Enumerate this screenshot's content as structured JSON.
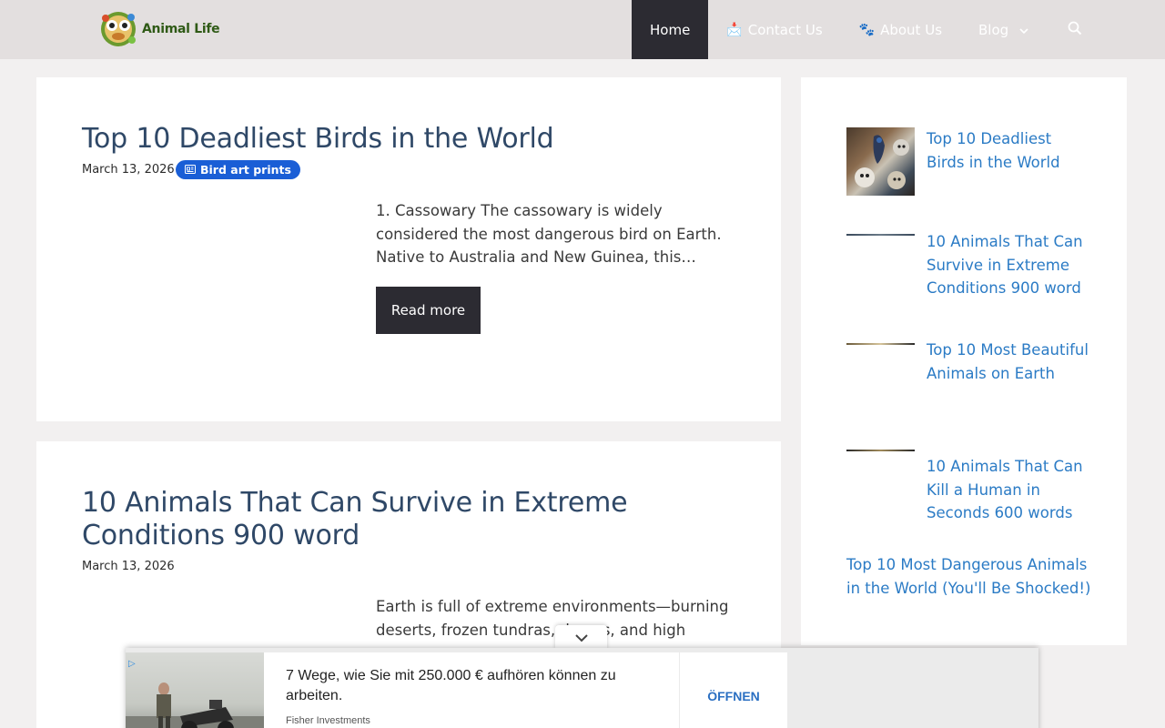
{
  "header": {
    "logo_text": "Animal Life",
    "nav": [
      {
        "label": "Home",
        "icon": "",
        "active": true
      },
      {
        "label": "Contact Us",
        "icon": "📩"
      },
      {
        "label": "About Us",
        "icon": "🐾"
      },
      {
        "label": "Blog",
        "icon": ""
      }
    ]
  },
  "posts": [
    {
      "title": "Top 10 Deadliest Birds in the World",
      "date": "March 13, 2026",
      "badge": "Bird art prints",
      "excerpt": "1. Cassowary The cassowary is widely considered the most dangerous bird on Earth. Native to Australia and New Guinea, this…",
      "read_more": "Read more"
    },
    {
      "title": "10 Animals That Can Survive in Extreme Conditions 900 word",
      "date": "March 13, 2026",
      "excerpt": "Earth is full of extreme environments—burning deserts, frozen tundras, d      eans, and high"
    }
  ],
  "sidebar": {
    "items": [
      {
        "label": "Top 10 Deadliest Birds in the World"
      },
      {
        "label": "10 Animals That Can Survive in Extreme Conditions 900 word"
      },
      {
        "label": "Top 10 Most Beautiful Animals on Earth"
      },
      {
        "label": "10 Animals That Can Kill a Human in Seconds 600 words"
      },
      {
        "label": "Top 10 Most Dangerous Animals in the World (You'll Be Shocked!)"
      }
    ]
  },
  "ad": {
    "title": "7 Wege, wie Sie mit 250.000 € aufhören können zu arbeiten.",
    "sponsor": "Fisher Investments",
    "cta": "ÖFFNEN",
    "info_icon": "▷"
  },
  "colors": {
    "header_bg": "#e3dfdf",
    "nav_active": "#2c2b32",
    "title": "#2f4867",
    "link": "#2b7bc5",
    "badge": "#1a5ed6"
  }
}
